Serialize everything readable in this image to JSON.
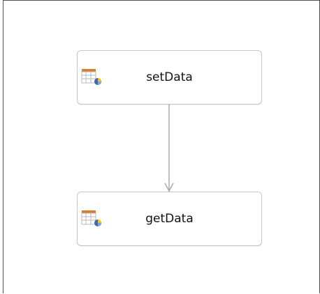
{
  "diagram": {
    "nodes": [
      {
        "id": "set",
        "label": "setData",
        "icon": "table-pie-chart-icon"
      },
      {
        "id": "get",
        "label": "getData",
        "icon": "table-pie-chart-icon"
      }
    ],
    "edges": [
      {
        "from": "setData",
        "to": "getData",
        "style": "arrow"
      }
    ],
    "colors": {
      "border": "#c7c7c7",
      "connector": "#aaaaaa",
      "table_header": "#d97c2b",
      "table_grid": "#b8b8b8",
      "pie_blue": "#3b67b6"
    }
  }
}
